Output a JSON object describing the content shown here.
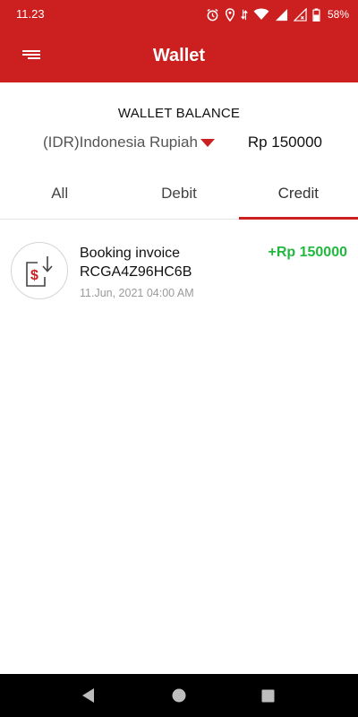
{
  "status_bar": {
    "time": "11.23",
    "battery": "58%"
  },
  "app_bar": {
    "title": "Wallet"
  },
  "balance": {
    "heading": "WALLET BALANCE",
    "currency": "(IDR)Indonesia Rupiah",
    "amount": "Rp 150000"
  },
  "tabs": [
    {
      "label": "All",
      "active": false
    },
    {
      "label": "Debit",
      "active": false
    },
    {
      "label": "Credit",
      "active": true
    }
  ],
  "transactions": [
    {
      "title": "Booking invoice",
      "reference": "RCGA4Z96HC6B",
      "date": "11.Jun, 2021 04:00 AM",
      "amount": "+Rp 150000",
      "icon": "invoice-download-icon"
    }
  ],
  "colors": {
    "brand": "#cc1f1f",
    "credit": "#22b83f"
  }
}
